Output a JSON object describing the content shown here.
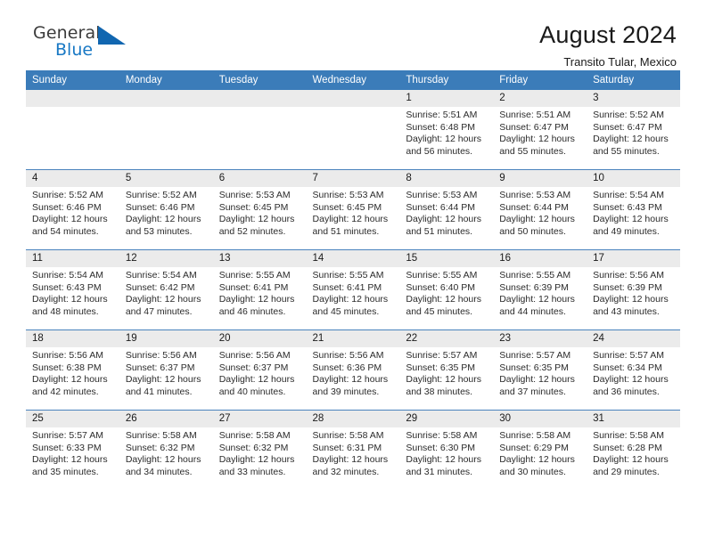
{
  "brand": {
    "name_part1": "General",
    "name_part2": "Blue",
    "triangle_color": "#1166b0",
    "blue_text_color": "#1878c4"
  },
  "header": {
    "title": "August 2024",
    "subtitle": "Transito Tular, Mexico",
    "header_bg": "#3b7cb9",
    "daynum_bg": "#ebebeb"
  },
  "weekday_headers": [
    "Sunday",
    "Monday",
    "Tuesday",
    "Wednesday",
    "Thursday",
    "Friday",
    "Saturday"
  ],
  "labels": {
    "sunrise": "Sunrise:",
    "sunset": "Sunset:",
    "daylight": "Daylight:"
  },
  "weeks": [
    [
      {
        "day": "",
        "sunrise": "",
        "sunset": "",
        "daylight_a": "",
        "daylight_b": ""
      },
      {
        "day": "",
        "sunrise": "",
        "sunset": "",
        "daylight_a": "",
        "daylight_b": ""
      },
      {
        "day": "",
        "sunrise": "",
        "sunset": "",
        "daylight_a": "",
        "daylight_b": ""
      },
      {
        "day": "",
        "sunrise": "",
        "sunset": "",
        "daylight_a": "",
        "daylight_b": ""
      },
      {
        "day": "1",
        "sunrise": "Sunrise: 5:51 AM",
        "sunset": "Sunset: 6:48 PM",
        "daylight_a": "Daylight: 12 hours",
        "daylight_b": "and 56 minutes."
      },
      {
        "day": "2",
        "sunrise": "Sunrise: 5:51 AM",
        "sunset": "Sunset: 6:47 PM",
        "daylight_a": "Daylight: 12 hours",
        "daylight_b": "and 55 minutes."
      },
      {
        "day": "3",
        "sunrise": "Sunrise: 5:52 AM",
        "sunset": "Sunset: 6:47 PM",
        "daylight_a": "Daylight: 12 hours",
        "daylight_b": "and 55 minutes."
      }
    ],
    [
      {
        "day": "4",
        "sunrise": "Sunrise: 5:52 AM",
        "sunset": "Sunset: 6:46 PM",
        "daylight_a": "Daylight: 12 hours",
        "daylight_b": "and 54 minutes."
      },
      {
        "day": "5",
        "sunrise": "Sunrise: 5:52 AM",
        "sunset": "Sunset: 6:46 PM",
        "daylight_a": "Daylight: 12 hours",
        "daylight_b": "and 53 minutes."
      },
      {
        "day": "6",
        "sunrise": "Sunrise: 5:53 AM",
        "sunset": "Sunset: 6:45 PM",
        "daylight_a": "Daylight: 12 hours",
        "daylight_b": "and 52 minutes."
      },
      {
        "day": "7",
        "sunrise": "Sunrise: 5:53 AM",
        "sunset": "Sunset: 6:45 PM",
        "daylight_a": "Daylight: 12 hours",
        "daylight_b": "and 51 minutes."
      },
      {
        "day": "8",
        "sunrise": "Sunrise: 5:53 AM",
        "sunset": "Sunset: 6:44 PM",
        "daylight_a": "Daylight: 12 hours",
        "daylight_b": "and 51 minutes."
      },
      {
        "day": "9",
        "sunrise": "Sunrise: 5:53 AM",
        "sunset": "Sunset: 6:44 PM",
        "daylight_a": "Daylight: 12 hours",
        "daylight_b": "and 50 minutes."
      },
      {
        "day": "10",
        "sunrise": "Sunrise: 5:54 AM",
        "sunset": "Sunset: 6:43 PM",
        "daylight_a": "Daylight: 12 hours",
        "daylight_b": "and 49 minutes."
      }
    ],
    [
      {
        "day": "11",
        "sunrise": "Sunrise: 5:54 AM",
        "sunset": "Sunset: 6:43 PM",
        "daylight_a": "Daylight: 12 hours",
        "daylight_b": "and 48 minutes."
      },
      {
        "day": "12",
        "sunrise": "Sunrise: 5:54 AM",
        "sunset": "Sunset: 6:42 PM",
        "daylight_a": "Daylight: 12 hours",
        "daylight_b": "and 47 minutes."
      },
      {
        "day": "13",
        "sunrise": "Sunrise: 5:55 AM",
        "sunset": "Sunset: 6:41 PM",
        "daylight_a": "Daylight: 12 hours",
        "daylight_b": "and 46 minutes."
      },
      {
        "day": "14",
        "sunrise": "Sunrise: 5:55 AM",
        "sunset": "Sunset: 6:41 PM",
        "daylight_a": "Daylight: 12 hours",
        "daylight_b": "and 45 minutes."
      },
      {
        "day": "15",
        "sunrise": "Sunrise: 5:55 AM",
        "sunset": "Sunset: 6:40 PM",
        "daylight_a": "Daylight: 12 hours",
        "daylight_b": "and 45 minutes."
      },
      {
        "day": "16",
        "sunrise": "Sunrise: 5:55 AM",
        "sunset": "Sunset: 6:39 PM",
        "daylight_a": "Daylight: 12 hours",
        "daylight_b": "and 44 minutes."
      },
      {
        "day": "17",
        "sunrise": "Sunrise: 5:56 AM",
        "sunset": "Sunset: 6:39 PM",
        "daylight_a": "Daylight: 12 hours",
        "daylight_b": "and 43 minutes."
      }
    ],
    [
      {
        "day": "18",
        "sunrise": "Sunrise: 5:56 AM",
        "sunset": "Sunset: 6:38 PM",
        "daylight_a": "Daylight: 12 hours",
        "daylight_b": "and 42 minutes."
      },
      {
        "day": "19",
        "sunrise": "Sunrise: 5:56 AM",
        "sunset": "Sunset: 6:37 PM",
        "daylight_a": "Daylight: 12 hours",
        "daylight_b": "and 41 minutes."
      },
      {
        "day": "20",
        "sunrise": "Sunrise: 5:56 AM",
        "sunset": "Sunset: 6:37 PM",
        "daylight_a": "Daylight: 12 hours",
        "daylight_b": "and 40 minutes."
      },
      {
        "day": "21",
        "sunrise": "Sunrise: 5:56 AM",
        "sunset": "Sunset: 6:36 PM",
        "daylight_a": "Daylight: 12 hours",
        "daylight_b": "and 39 minutes."
      },
      {
        "day": "22",
        "sunrise": "Sunrise: 5:57 AM",
        "sunset": "Sunset: 6:35 PM",
        "daylight_a": "Daylight: 12 hours",
        "daylight_b": "and 38 minutes."
      },
      {
        "day": "23",
        "sunrise": "Sunrise: 5:57 AM",
        "sunset": "Sunset: 6:35 PM",
        "daylight_a": "Daylight: 12 hours",
        "daylight_b": "and 37 minutes."
      },
      {
        "day": "24",
        "sunrise": "Sunrise: 5:57 AM",
        "sunset": "Sunset: 6:34 PM",
        "daylight_a": "Daylight: 12 hours",
        "daylight_b": "and 36 minutes."
      }
    ],
    [
      {
        "day": "25",
        "sunrise": "Sunrise: 5:57 AM",
        "sunset": "Sunset: 6:33 PM",
        "daylight_a": "Daylight: 12 hours",
        "daylight_b": "and 35 minutes."
      },
      {
        "day": "26",
        "sunrise": "Sunrise: 5:58 AM",
        "sunset": "Sunset: 6:32 PM",
        "daylight_a": "Daylight: 12 hours",
        "daylight_b": "and 34 minutes."
      },
      {
        "day": "27",
        "sunrise": "Sunrise: 5:58 AM",
        "sunset": "Sunset: 6:32 PM",
        "daylight_a": "Daylight: 12 hours",
        "daylight_b": "and 33 minutes."
      },
      {
        "day": "28",
        "sunrise": "Sunrise: 5:58 AM",
        "sunset": "Sunset: 6:31 PM",
        "daylight_a": "Daylight: 12 hours",
        "daylight_b": "and 32 minutes."
      },
      {
        "day": "29",
        "sunrise": "Sunrise: 5:58 AM",
        "sunset": "Sunset: 6:30 PM",
        "daylight_a": "Daylight: 12 hours",
        "daylight_b": "and 31 minutes."
      },
      {
        "day": "30",
        "sunrise": "Sunrise: 5:58 AM",
        "sunset": "Sunset: 6:29 PM",
        "daylight_a": "Daylight: 12 hours",
        "daylight_b": "and 30 minutes."
      },
      {
        "day": "31",
        "sunrise": "Sunrise: 5:58 AM",
        "sunset": "Sunset: 6:28 PM",
        "daylight_a": "Daylight: 12 hours",
        "daylight_b": "and 29 minutes."
      }
    ]
  ]
}
